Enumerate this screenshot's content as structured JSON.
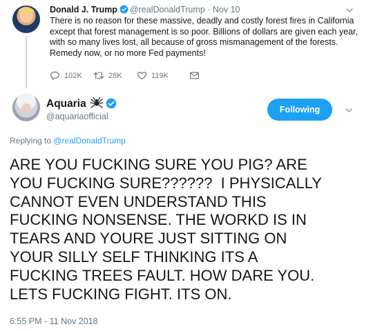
{
  "parent_tweet": {
    "author_name": "Donald J. Trump",
    "handle": "@realDonaldTrump",
    "separator": "·",
    "time": "Nov 10",
    "text": "There is no reason for these massive, deadly and costly forest fires in California except that forest management is so poor. Billions of dollars are given each year, with so many lives lost, all because of gross mismanagement of the forests. Remedy now, or no more Fed payments!",
    "replies": "102K",
    "retweets": "28K",
    "likes": "119K"
  },
  "main_tweet": {
    "author_name": "Aquaria",
    "handle": "@aquariaofficial",
    "follow_label": "Following",
    "replying_prefix": "Replying to ",
    "replying_to": "@realDonaldTrump",
    "text": "ARE YOU FUCKING SURE YOU PIG? ARE\nYOU FUCKING SURE??????  I PHYSICALLY\nCANNOT EVEN UNDERSTAND THIS\nFUCKING NONSENSE. THE WORKD IS IN\nTEARS AND YOURE JUST SITTING ON\nYOUR SILLY SELF THINKING ITS A\nFUCKING TREES FAULT. HOW DARE YOU.\nLETS FUCKING FIGHT. ITS ON.",
    "timestamp": "6:55 PM - 11 Nov 2018"
  },
  "colors": {
    "accent": "#1da1f2",
    "muted": "#657786",
    "text": "#14171a",
    "thread_line": "#ccd6dd"
  },
  "icons": {
    "verified": "verified-badge-icon",
    "reply": "reply-icon",
    "retweet": "retweet-icon",
    "like": "heart-icon",
    "message": "envelope-icon",
    "menu": "chevron-down-icon",
    "emoji": "spider-emoji-icon"
  }
}
